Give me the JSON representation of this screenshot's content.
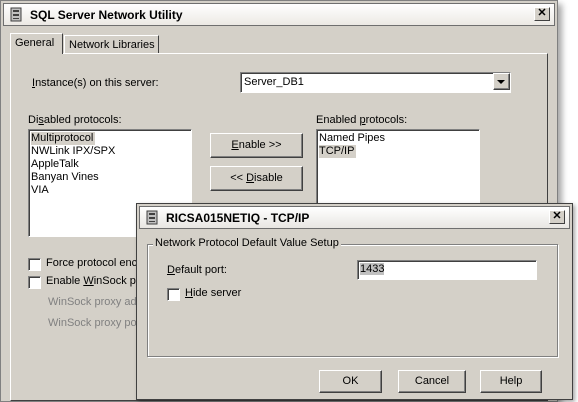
{
  "main_window": {
    "title": "SQL Server Network Utility",
    "close_glyph": "✕",
    "tabs": [
      {
        "label": "General"
      },
      {
        "label": "Network Libraries"
      }
    ],
    "instance": {
      "label_underlined": "I",
      "label_rest": "nstance(s) on this server:",
      "value": "Server_DB1"
    },
    "disabled_protocols": {
      "label_pre": "Di",
      "label_underlined": "s",
      "label_post": "abled protocols:",
      "items": [
        "Multiprotocol",
        "NWLink IPX/SPX",
        "AppleTalk",
        "Banyan Vines",
        "VIA"
      ],
      "selected_index": 0
    },
    "enabled_protocols": {
      "label_pre": "Enabled ",
      "label_underlined": "p",
      "label_post": "rotocols:",
      "items": [
        "Named Pipes",
        "TCP/IP"
      ],
      "selected_index": 1
    },
    "enable_button": {
      "underlined": "E",
      "rest": "nable >>"
    },
    "disable_button": {
      "pre": "<< ",
      "underlined": "D",
      "rest": "isable"
    },
    "force_protocol": {
      "label": "Force protocol enc"
    },
    "enable_winsock": {
      "label_pre": "Enable ",
      "label_underlined": "W",
      "label_post": "inSock p"
    },
    "winsock_address": "WinSock proxy ad",
    "winsock_port": "WinSock proxy po"
  },
  "dialog": {
    "title": "RICSA015NETIQ - TCP/IP",
    "close_glyph": "✕",
    "group_title": "Network Protocol Default Value Setup",
    "default_port": {
      "label_underlined": "D",
      "label_rest": "efault port:",
      "value": "1433"
    },
    "hide_server": {
      "label_underlined": "H",
      "label_rest": "ide server",
      "checked": false
    },
    "ok_label": "OK",
    "cancel_label": "Cancel",
    "help_label": "Help"
  }
}
